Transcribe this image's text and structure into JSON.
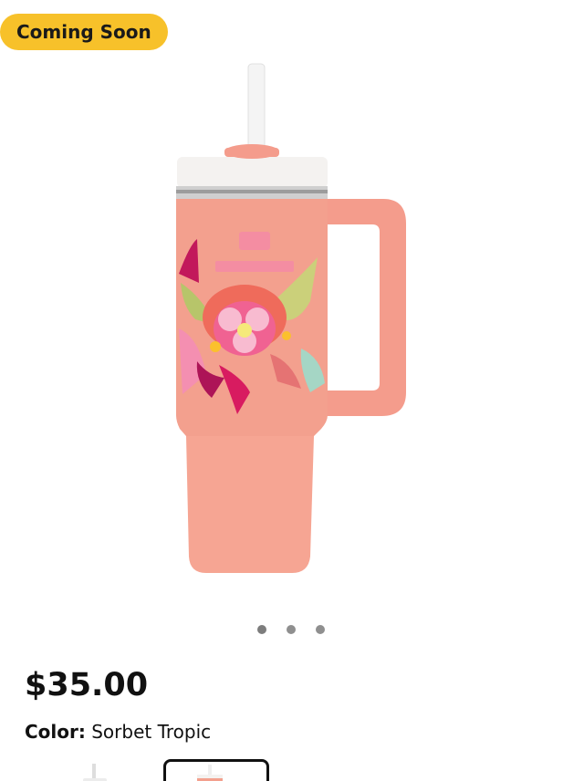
{
  "badge": {
    "label": "Coming Soon"
  },
  "product": {
    "image_name": "tumbler-product-image",
    "carousel": {
      "slide_count": 3,
      "active_index": 0
    },
    "price": "$35.00",
    "color_label": "Color:",
    "color_value": "Sorbet Tropic",
    "swatches": [
      {
        "name": "white-variant",
        "selected": false
      },
      {
        "name": "sorbet-tropic-variant",
        "selected": true
      }
    ]
  },
  "colors": {
    "badge": "#f7c12a",
    "tumbler_body": "#f3a08e",
    "lid": "#f4f2f0",
    "handle": "#f49c8c",
    "dot_active": "#7d7d7d"
  }
}
